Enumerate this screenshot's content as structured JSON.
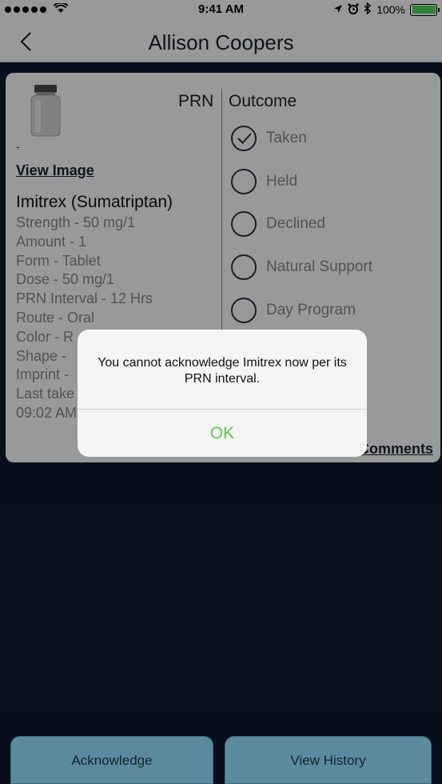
{
  "status_bar": {
    "time": "9:41 AM",
    "battery": "100%",
    "battery_level": 1.0,
    "icons": [
      "signal-dots",
      "wifi-icon",
      "location-icon",
      "alarm-icon",
      "bluetooth-icon",
      "battery-icon"
    ]
  },
  "nav": {
    "title": "Allison Coopers",
    "back_icon": "chevron-left-icon"
  },
  "medication": {
    "image_icon": "pill-bottle-icon",
    "dash": "-",
    "view_image": "View Image",
    "type": "PRN",
    "name": "Imitrex (Sumatriptan)",
    "details": [
      "Strength - 50 mg/1",
      "Amount - 1",
      "Form - Tablet",
      "Dose - 50 mg/1",
      "PRN Interval - 12 Hrs",
      "Route - Oral",
      "Color - R",
      "Shape - ",
      "Imprint - ",
      "Last take",
      "09:02 AM"
    ]
  },
  "outcome": {
    "title": "Outcome",
    "options": [
      {
        "label": "Taken",
        "checked": true
      },
      {
        "label": "Held",
        "checked": false
      },
      {
        "label": "Declined",
        "checked": false
      },
      {
        "label": "Natural Support",
        "checked": false
      },
      {
        "label": "Day Program",
        "checked": false
      }
    ]
  },
  "comments_link": "Comments",
  "alert": {
    "message": "You cannot acknowledge Imitrex now per its PRN interval.",
    "ok": "OK",
    "ok_color": "#5cc84a"
  },
  "buttons": {
    "acknowledge": "Acknowledge",
    "view_history": "View History"
  },
  "colors": {
    "background": "#0d1a30",
    "button": "#5b8aa0"
  }
}
